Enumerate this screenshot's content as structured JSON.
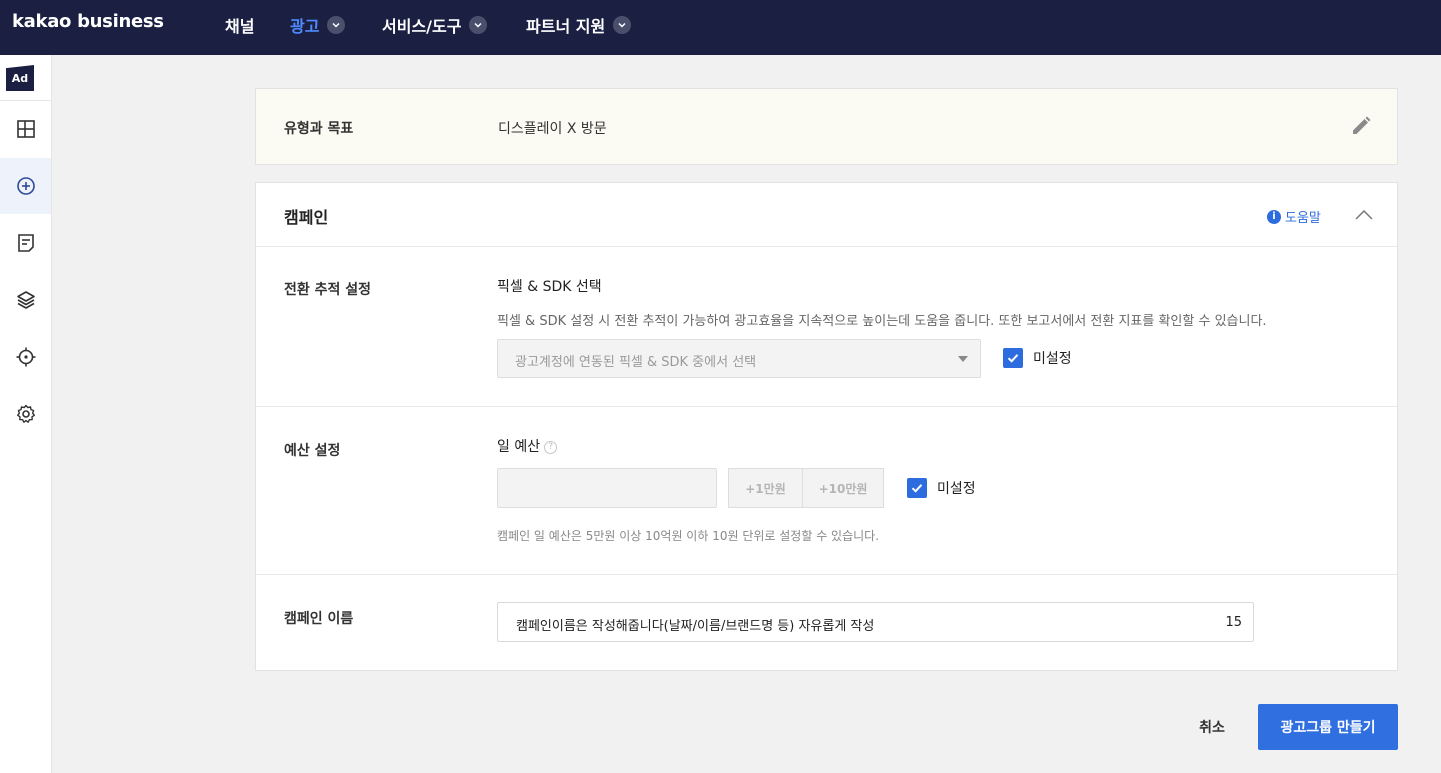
{
  "topbar": {
    "brand": "kakao business",
    "nav": [
      {
        "label": "채널"
      },
      {
        "label": "광고"
      },
      {
        "label": "서비스/도구"
      },
      {
        "label": "파트너 지원"
      }
    ]
  },
  "siderail": {
    "logo": "Ad",
    "items": [
      "dashboard-icon",
      "add-circle-icon",
      "report-icon",
      "layers-icon",
      "target-icon",
      "settings-icon"
    ],
    "active_item": "add-circle-icon"
  },
  "goal": {
    "label": "유형과 목표",
    "value": "디스플레이 X 방문",
    "edit_icon": "pencil-icon"
  },
  "campaign": {
    "title": "캠페인",
    "help_label": "도움말",
    "conversion": {
      "label": "전환 추적 설정",
      "subtitle": "픽셀 & SDK 선택",
      "description": "픽셀 & SDK 설정 시 전환 추적이 가능하여 광고효율을 지속적으로 높이는데 도움을 줍니다. 또한 보고서에서 전환 지표를 확인할 수 있습니다.",
      "select_placeholder": "광고계정에 연동된 픽셀 & SDK 중에서 선택",
      "unset_label": "미설정"
    },
    "budget": {
      "label": "예산 설정",
      "subtitle": "일 예산",
      "help_glyph": "?",
      "add_1": "+1만원",
      "add_10": "+10만원",
      "unset_label": "미설정",
      "hint": "캠페인 일 예산은 5만원 이상 10억원 이하 10원 단위로 설정할 수 있습니다."
    },
    "name": {
      "label": "캠페인 이름",
      "value": "캠페인이름은 작성해줍니다(날짜/이름/브랜드명 등) 자유롭게 작성",
      "count": "15"
    }
  },
  "actions": {
    "cancel": "취소",
    "create": "광고그룹 만들기"
  },
  "colors": {
    "topbar_bg": "#1b2043",
    "accent": "#2f6fe0",
    "active_nav": "#4f8bff"
  }
}
